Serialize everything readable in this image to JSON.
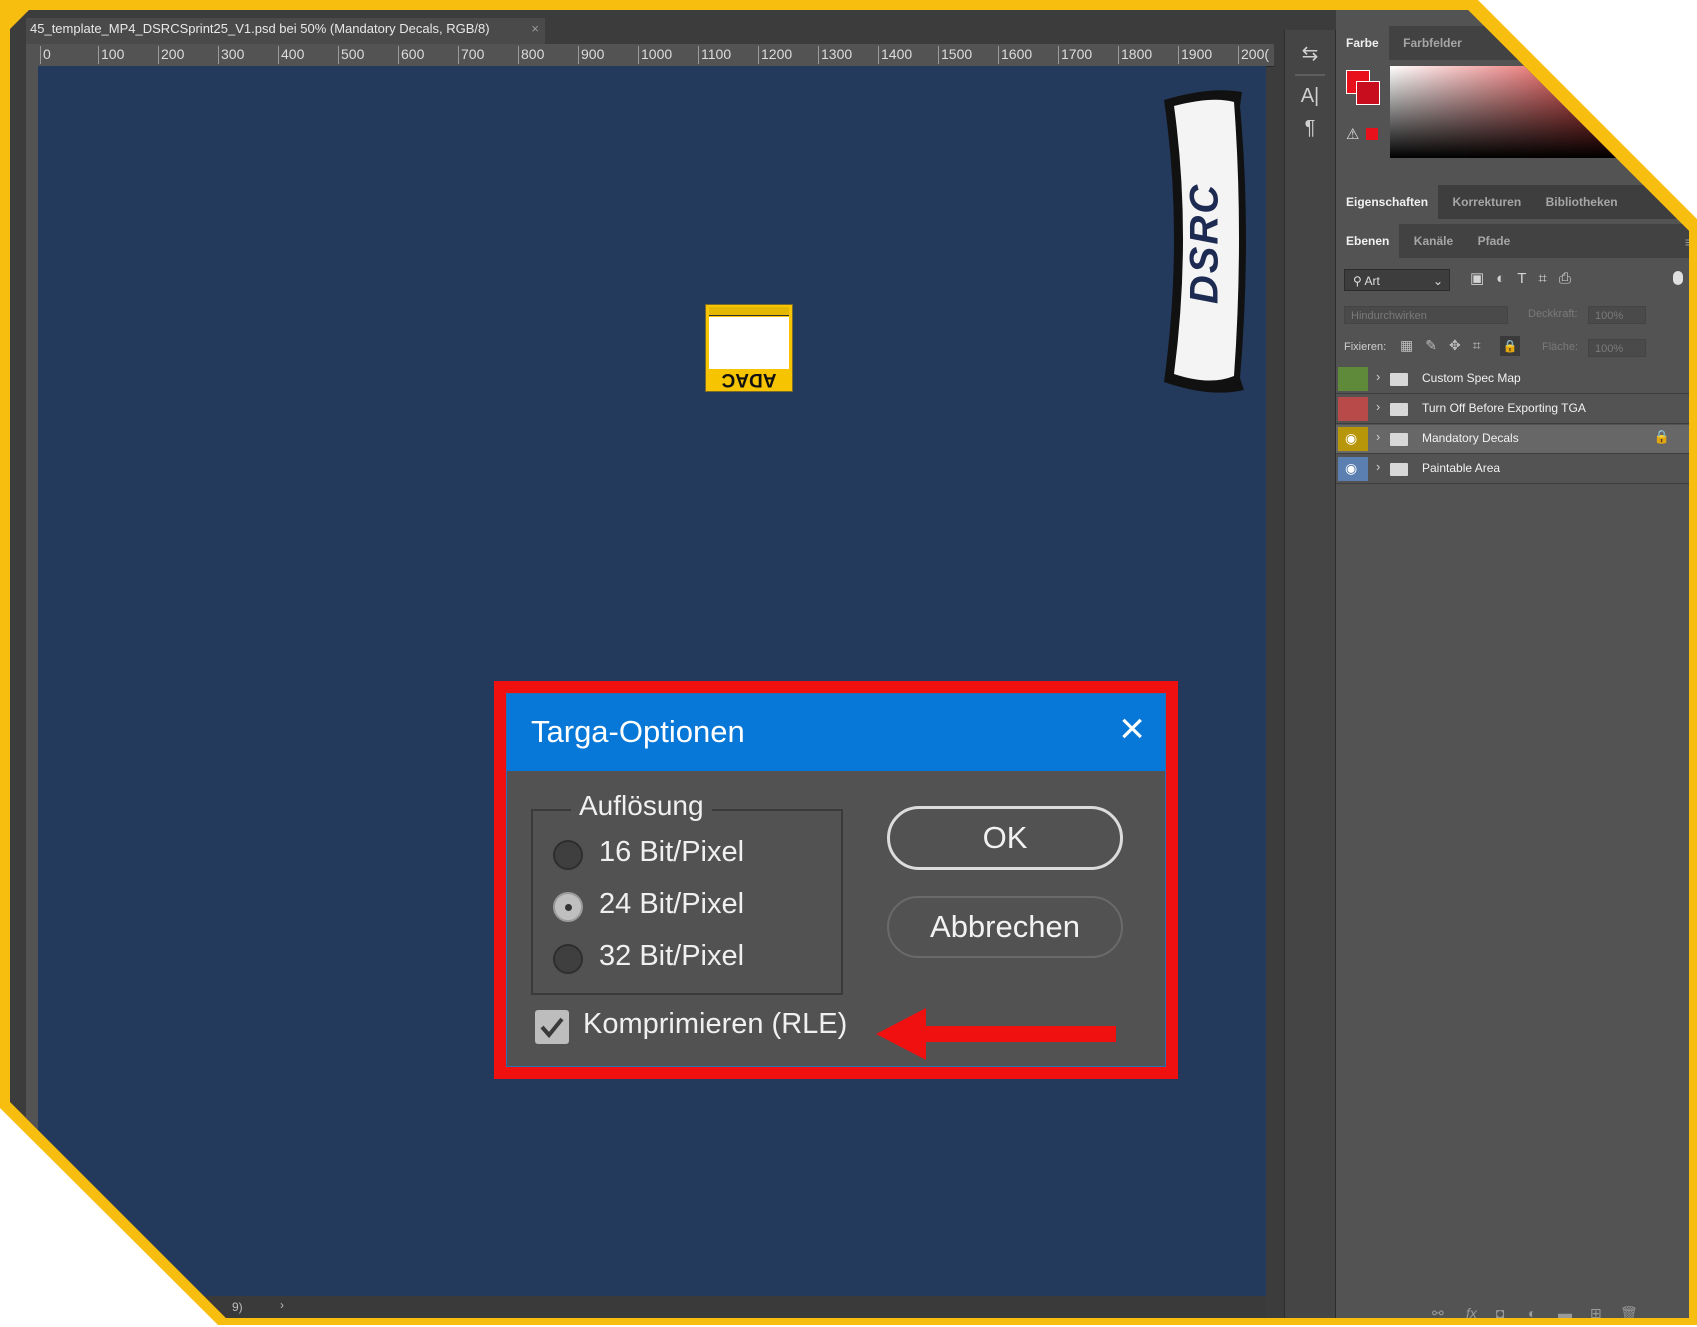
{
  "document": {
    "tab_title": "45_template_MP4_DSRCSprint25_V1.psd bei 50% (Mandatory Decals, RGB/8)",
    "tab_close": "×",
    "ruler_ticks": [
      "0",
      "100",
      "200",
      "300",
      "400",
      "500",
      "600",
      "700",
      "800",
      "900",
      "1000",
      "1100",
      "1200",
      "1300",
      "1400",
      "1500",
      "1600",
      "1700",
      "1800",
      "1900",
      "200("
    ],
    "canvas_color": "#243a5c",
    "decal_adac_label": "ADAC",
    "decal_dsrc_label": "DSRC",
    "status_text": "9)"
  },
  "color_panel": {
    "tabs": [
      "Farbe",
      "Farbfelder"
    ],
    "active_tab": "Farbe",
    "foreground": "#e8101a",
    "background": "#c80e1e"
  },
  "properties_panel": {
    "tabs": [
      "Eigenschaften",
      "Korrekturen",
      "Bibliotheken"
    ],
    "active_tab": "Eigenschaften"
  },
  "layers_panel": {
    "tabs": [
      "Ebenen",
      "Kanäle",
      "Pfade"
    ],
    "active_tab": "Ebenen",
    "filter_label": "Art",
    "blend_mode": "Hindurchwirken",
    "opacity_label": "Deckkraft:",
    "opacity_value": "100%",
    "lock_label": "Fixieren:",
    "fill_label": "Fläche:",
    "fill_value": "100%",
    "layers": [
      {
        "name": "Custom Spec Map",
        "color": "#5e8a3a",
        "visible": false,
        "locked": false,
        "selected": false
      },
      {
        "name": "Turn Off Before Exporting TGA",
        "color": "#b84a4a",
        "visible": false,
        "locked": false,
        "selected": false
      },
      {
        "name": "Mandatory Decals",
        "color": "#b8960a",
        "visible": true,
        "locked": true,
        "selected": true
      },
      {
        "name": "Paintable Area",
        "color": "#5a7fb0",
        "visible": true,
        "locked": false,
        "selected": false
      }
    ]
  },
  "dialog": {
    "title": "Targa-Optionen",
    "close_symbol": "×",
    "group_label": "Auflösung",
    "options": [
      {
        "label": "16 Bit/Pixel",
        "checked": false
      },
      {
        "label": "24 Bit/Pixel",
        "checked": true
      },
      {
        "label": "32 Bit/Pixel",
        "checked": false
      }
    ],
    "ok_label": "OK",
    "cancel_label": "Abbrechen",
    "compress_label": "Komprimieren (RLE)",
    "compress_checked": true
  },
  "annotations": {
    "frame_color": "#f7bd0f",
    "highlight_color": "#f01010",
    "arrow_color": "#f01010"
  }
}
